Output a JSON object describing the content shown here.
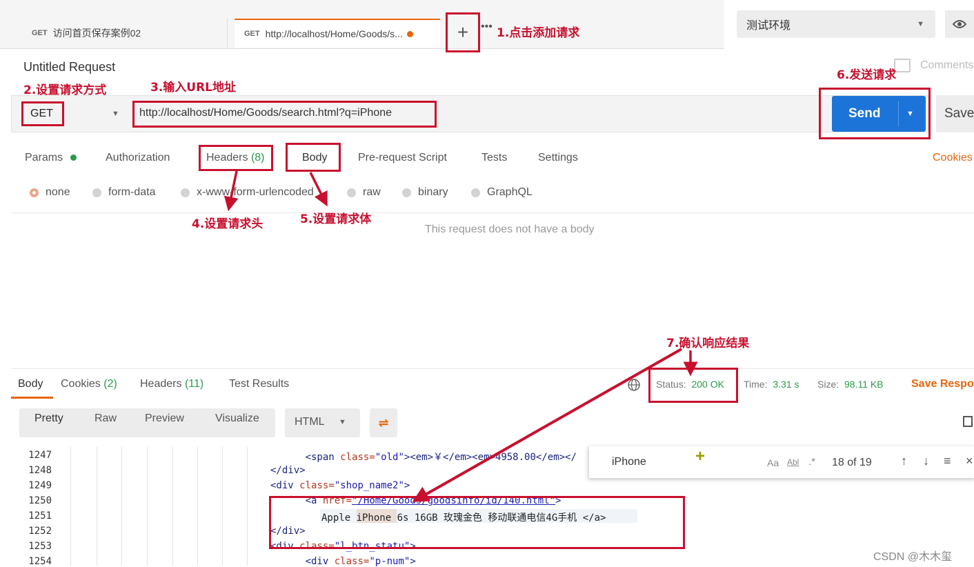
{
  "tabs": [
    {
      "method": "GET",
      "label": "访问首页保存案例02"
    },
    {
      "method": "GET",
      "label": "http://localhost/Home/Goods/s..."
    }
  ],
  "new_tab_icon": "plus-icon",
  "more_tabs": "•••",
  "environment": {
    "selected": "测试环境",
    "eye_icon": "eye-icon"
  },
  "request": {
    "title": "Untitled Request",
    "comments": "Comments",
    "method": "GET",
    "url": "http://localhost/Home/Goods/search.html?q=iPhone",
    "send": "Send",
    "save": "Save"
  },
  "request_tabs": [
    "Params",
    "Authorization",
    "Headers",
    "(8)",
    "Body",
    "Pre-request Script",
    "Tests",
    "Settings",
    "Cookies"
  ],
  "body_types": [
    "none",
    "form-data",
    "x-www-form-urlencoded",
    "raw",
    "binary",
    "GraphQL"
  ],
  "body_empty_text": "This request does not have a body",
  "response": {
    "tabs": [
      {
        "label": "Body",
        "count": ""
      },
      {
        "label": "Cookies",
        "count": "(2)"
      },
      {
        "label": "Headers",
        "count": "(11)"
      },
      {
        "label": "Test Results",
        "count": ""
      }
    ],
    "status_label": "Status:",
    "status_value": "200 OK",
    "time_label": "Time:",
    "time_value": "3.31 s",
    "size_label": "Size:",
    "size_value": "98.11 KB",
    "save_response": "Save Respo",
    "view_modes": [
      "Pretty",
      "Raw",
      "Preview",
      "Visualize"
    ],
    "format": "HTML"
  },
  "search": {
    "value": "iPhone",
    "match_case": "Aa",
    "whole_word": "Abl",
    "regex": ".*",
    "count": "18 of 19"
  },
  "code_lines": [
    {
      "num": "1247",
      "indent": "      ",
      "tag_open": "<span ",
      "attr": "class=",
      "val": "\"old\"",
      "rest": "><em>￥</em><em>4958.00</em></"
    },
    {
      "num": "1248",
      "indent": "",
      "tag_open": "</div>",
      "attr": "",
      "val": "",
      "rest": ""
    },
    {
      "num": "1249",
      "indent": "",
      "tag_open": "<div ",
      "attr": "class=",
      "val": "\"shop_name2\"",
      "rest": ">"
    },
    {
      "num": "1250",
      "indent": "      ",
      "tag_open": "<a ",
      "attr": "href=",
      "val": "\"/Home/Goods/goodsinfo/id/140.html\"",
      "rest": ">"
    },
    {
      "num": "1251",
      "indent": "",
      "tag_open": "",
      "attr": "",
      "val": "",
      "rest": "Apple iPhone 6s 16GB 玫瑰金色 移动联通电信4G手机 </a>"
    },
    {
      "num": "1252",
      "indent": "",
      "tag_open": "</div>",
      "attr": "",
      "val": "",
      "rest": ""
    },
    {
      "num": "1253",
      "indent": "",
      "tag_open": "<div ",
      "attr": "class=",
      "val": "\"l_btn_statu\"",
      "rest": ">"
    },
    {
      "num": "1254",
      "indent": "      ",
      "tag_open": "<div ",
      "attr": "class=",
      "val": "\"p-num\"",
      "rest": ">"
    }
  ],
  "annotations": [
    "1.点击添加请求",
    "2.设置请求方式",
    "3.输入URL地址",
    "4.设置请求头",
    "5.设置请求体",
    "6.发送请求",
    "7.确认响应结果"
  ],
  "watermark": "CSDN @木木玺",
  "colors": {
    "accent": "#e8650a",
    "annotation": "#c8102e",
    "send": "#1d74d8",
    "success": "#2a9a4a"
  }
}
